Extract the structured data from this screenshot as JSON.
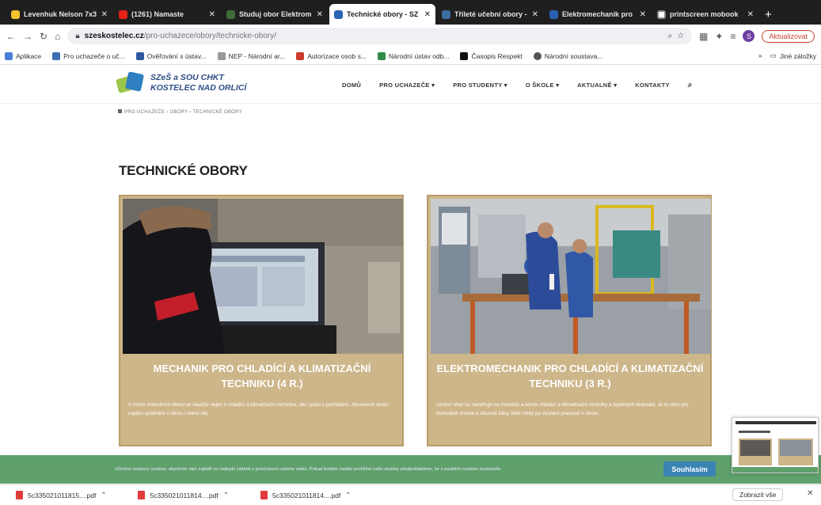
{
  "browser": {
    "tabs": [
      {
        "title": "Levenhuk Nelson 7x3",
        "favicon_color": "#f2c22e",
        "active": false
      },
      {
        "title": "(1261) Namaste",
        "favicon_color": "#e62117",
        "active": false
      },
      {
        "title": "Studuj obor Elektrom",
        "favicon_color": "#3c6e36",
        "active": false
      },
      {
        "title": "Technické obory - SZ",
        "favicon_color": "#2c65b5",
        "active": true
      },
      {
        "title": "Tříleté učební obory -",
        "favicon_color": "#3c6e9e",
        "active": false
      },
      {
        "title": "Elektromechanik pro",
        "favicon_color": "#2a5fb0",
        "active": false
      },
      {
        "title": "printscreen mobook",
        "favicon_color": "#ffffff",
        "active": false
      }
    ],
    "new_tab_label": "+",
    "url_host": "szeskostelec.cz",
    "url_path": "/pro-uchazece/obory/technicke-obory/",
    "update_button": "Aktualizovat",
    "profile_letter": "S",
    "bookmarks": [
      {
        "label": "Aplikace",
        "color": "#4a7fd8"
      },
      {
        "label": "Pro uchazeče o uč...",
        "color": "#3b6fb8"
      },
      {
        "label": "Ověřování s ústav...",
        "color": "#2f5aa0"
      },
      {
        "label": "NEP - Národní ar...",
        "color": "#999999"
      },
      {
        "label": "Autorizace osob s...",
        "color": "#cc3a2e"
      },
      {
        "label": "Národní ústav odb...",
        "color": "#2f8a4a"
      },
      {
        "label": "Časopis Respekt",
        "color": "#111111"
      },
      {
        "label": "Národní soustava...",
        "color": "#555555"
      }
    ],
    "other_bookmarks": "Jiné záložky"
  },
  "site": {
    "logo_line1": "SZeŠ a SOU CHKT",
    "logo_line2": "KOSTELEC NAD ORLICÍ",
    "nav": [
      "DOMŮ",
      "PRO UCHAZEČE ▾",
      "PRO STUDENTY ▾",
      "O ŠKOLE ▾",
      "AKTUALNĚ ▾",
      "KONTAKTY"
    ],
    "breadcrumb": "PRO UCHAZEČE › OBORY › TECHNICKÉ OBORY",
    "page_title": "TECHNICKÉ OBORY",
    "cards": [
      {
        "title": "MECHANIK PRO CHLADÍCÍ A KLIMATIZAČNÍ TECHNIKU (4 R.)",
        "description": "V tomto maturitním oboru se naučíte nejen o chladicí a klimatizační technice, ale i práci s počítačem. Absolventi oboru najdou uplatnění v oboru i mimo něj."
      },
      {
        "title": "ELEKTROMECHANIK PRO CHLADÍCÍ A KLIMATIZAČNÍ TECHNIKU (3 R.)",
        "description": "Učební obor se zaměřuje na montáže a servis chladicí a klimatizační techniky a tepelných čerpadel. Je to obor pro manuálně zručné a šikovné žáky, kteří chtějí po vyučení pracovat v oboru."
      }
    ],
    "cookie_text": "Učiníme soubory cookies, abychom vám zajistili co nejlepší zážitek z procházení našeho webu. Pokud budete nadále prohlížet naše stránky předpokládáme, že s použitím cookies souhlasíte.",
    "cookie_button": "Souhlasím"
  },
  "downloads": [
    {
      "name": "5c335021011815....pdf"
    },
    {
      "name": "5c335021011814....pdf"
    },
    {
      "name": "5c335021011814....pdf"
    }
  ],
  "show_all": "Zobrazit vše"
}
